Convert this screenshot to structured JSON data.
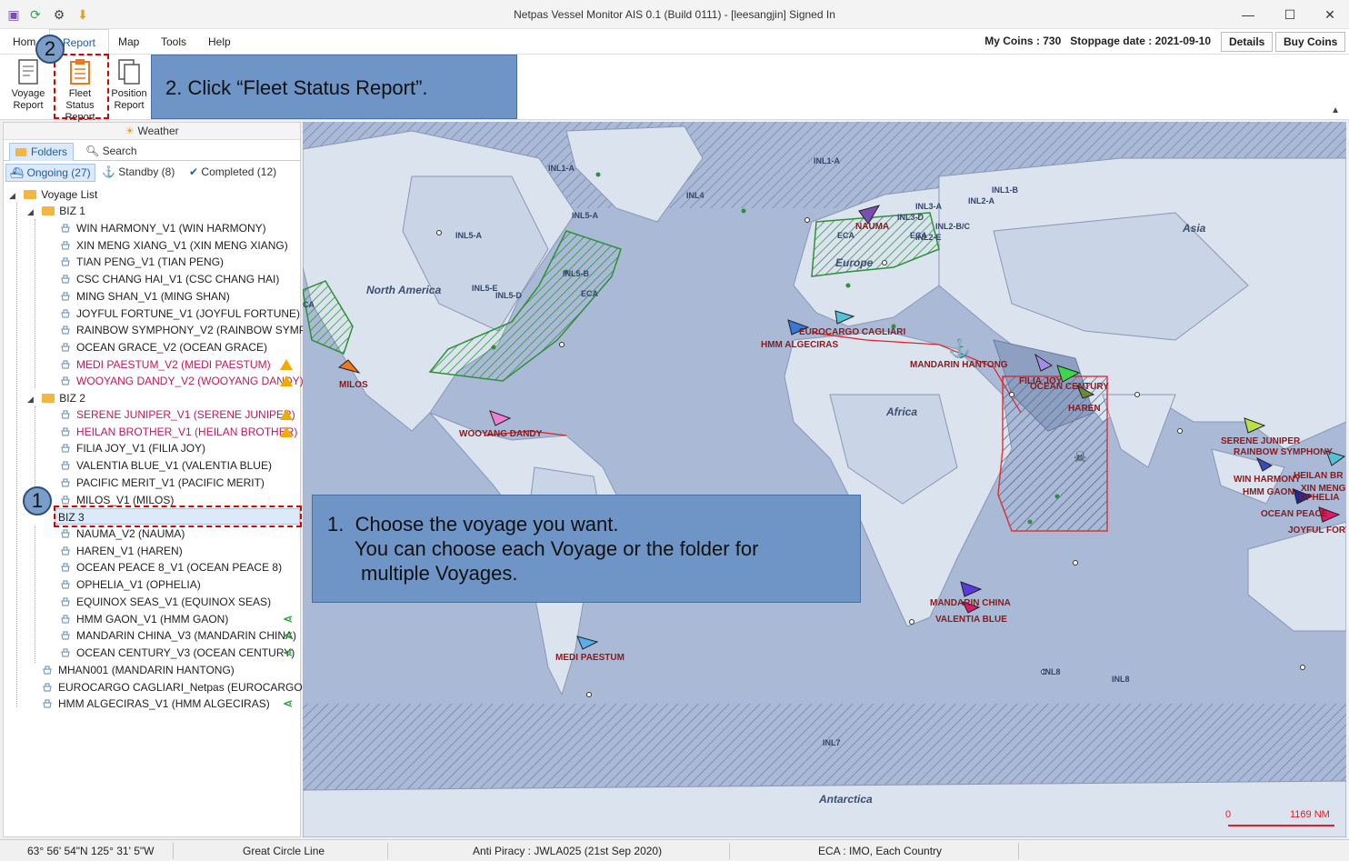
{
  "window": {
    "title": "Netpas Vessel Monitor AIS 0.1 (Build 0111) - [leesangjin] Signed In",
    "controls": [
      "—",
      "☐",
      "✕"
    ]
  },
  "menu": {
    "items": [
      "Hom",
      "Report",
      "Map",
      "Tools",
      "Help"
    ],
    "active": "Report",
    "coins_text": "My Coins : 730   Stoppage date : 2021-09-10",
    "details_label": "Details",
    "buy_label": "Buy Coins"
  },
  "ribbon": {
    "voyage_report": [
      "Voyage",
      "Report"
    ],
    "fleet_status_report": [
      "Fleet Status",
      "Report"
    ],
    "position_report": [
      "Position",
      "Report"
    ]
  },
  "callouts": {
    "step2": "2. Click “Fleet Status Report”.",
    "step1_line1": "1.  Choose the voyage you want.",
    "step1_line2": "You can choose each Voyage or the folder for",
    "step1_line3": "multiple Voyages.",
    "badge1": "1",
    "badge2": "2"
  },
  "panel": {
    "weather": "Weather",
    "tab_folders": "Folders",
    "tab_search": "Search",
    "filter_ongoing": "Ongoing (27)",
    "filter_standby": "Standby (8)",
    "filter_completed": "Completed (12)",
    "root": "Voyage List",
    "biz1": "BIZ 1",
    "biz1_items": [
      {
        "label": "WIN HARMONY_V1 (WIN HARMONY)",
        "pink": false,
        "flag": ""
      },
      {
        "label": "XIN MENG XIANG_V1 (XIN MENG XIANG)",
        "pink": false,
        "flag": ""
      },
      {
        "label": "TIAN PENG_V1 (TIAN PENG)",
        "pink": false,
        "flag": ""
      },
      {
        "label": "CSC CHANG HAI_V1 (CSC CHANG HAI)",
        "pink": false,
        "flag": ""
      },
      {
        "label": "MING SHAN_V1 (MING SHAN)",
        "pink": false,
        "flag": ""
      },
      {
        "label": "JOYFUL FORTUNE_V1 (JOYFUL FORTUNE)",
        "pink": false,
        "flag": ""
      },
      {
        "label": "RAINBOW SYMPHONY_V2 (RAINBOW SYMPH...",
        "pink": false,
        "flag": ""
      },
      {
        "label": "OCEAN GRACE_V2 (OCEAN GRACE)",
        "pink": false,
        "flag": ""
      },
      {
        "label": "MEDI PAESTUM_V2 (MEDI PAESTUM)",
        "pink": true,
        "flag": "warn"
      },
      {
        "label": "WOOYANG DANDY_V2 (WOOYANG DANDY)",
        "pink": true,
        "flag": "warn"
      }
    ],
    "biz2": "BIZ 2",
    "biz2_items": [
      {
        "label": "SERENE JUNIPER_V1 (SERENE JUNIPER)",
        "pink": true,
        "flag": "warn"
      },
      {
        "label": "HEILAN BROTHER_V1 (HEILAN BROTHER)",
        "pink": true,
        "flag": "warn"
      },
      {
        "label": "FILIA JOY_V1 (FILIA JOY)",
        "pink": false,
        "flag": ""
      },
      {
        "label": "VALENTIA BLUE_V1 (VALENTIA BLUE)",
        "pink": false,
        "flag": ""
      },
      {
        "label": "PACIFIC MERIT_V1 (PACIFIC MERIT)",
        "pink": false,
        "flag": ""
      },
      {
        "label": "MILOS_V1 (MILOS)",
        "pink": false,
        "flag": ""
      }
    ],
    "biz3": "BIZ 3",
    "biz3_items": [
      {
        "label": "NAUMA_V2 (NAUMA)",
        "pink": false,
        "flag": ""
      },
      {
        "label": "HAREN_V1 (HAREN)",
        "pink": false,
        "flag": ""
      },
      {
        "label": "OCEAN PEACE 8_V1 (OCEAN PEACE 8)",
        "pink": false,
        "flag": ""
      },
      {
        "label": "OPHELIA_V1 (OPHELIA)",
        "pink": false,
        "flag": ""
      },
      {
        "label": "EQUINOX SEAS_V1 (EQUINOX SEAS)",
        "pink": false,
        "flag": ""
      },
      {
        "label": "HMM GAON_V1 (HMM GAON)",
        "pink": false,
        "flag": "share"
      },
      {
        "label": "MANDARIN CHINA_V3 (MANDARIN CHINA)",
        "pink": false,
        "flag": "share"
      },
      {
        "label": "OCEAN CENTURY_V3 (OCEAN CENTURY)",
        "pink": false,
        "flag": "share"
      }
    ],
    "root_items": [
      {
        "label": "MHAN001 (MANDARIN HANTONG)",
        "pink": false,
        "flag": ""
      },
      {
        "label": "EUROCARGO CAGLIARI_Netpas (EUROCARGO CAG...",
        "pink": false,
        "flag": ""
      },
      {
        "label": "HMM ALGECIRAS_V1 (HMM ALGECIRAS)",
        "pink": false,
        "flag": "share"
      }
    ]
  },
  "map": {
    "vessels": [
      "MILOS",
      "WOOYANG DANDY",
      "HMM ALGECIRAS",
      "EUROCARGO CAGLIARI",
      "NAUMA",
      "MANDARIN HANTONG",
      "FILIA JOY",
      "OCEAN CENTURY",
      "HAREN",
      "SERENE JUNIPER",
      "RAINBOW SYMPHONY",
      "WIN HARMONY",
      "HMM GAON",
      "OCEAN PEACE",
      "JOYFUL FORT",
      "HEILAN BR",
      "OPHELIA",
      "XIN MENG XI",
      "MANDARIN CHINA",
      "VALENTIA BLUE",
      "MEDI PAESTUM"
    ],
    "regions": [
      "North America",
      "Africa",
      "Europe",
      "Asia",
      "Antarctica"
    ],
    "zones": [
      "INL1-A",
      "INL1-A",
      "INL4",
      "INL5-A",
      "INL5-A",
      "INL5-B",
      "INL5-E",
      "INL5-D",
      "ECA",
      "ECA",
      "ECA",
      "INL3-A",
      "INL3-D",
      "INL2-A",
      "INL1-B",
      "INL2-B/C",
      "INL2-E",
      "INL8",
      "INL8",
      "INL7",
      "CA"
    ],
    "scale_start": "0",
    "scale_end": "1169 NM",
    "colors": {
      "sea": "#a9b9d6",
      "land": "#dbe3ef",
      "land_dark": "#8ea0c2",
      "eca": "#2f8f3a",
      "piracy": "#e02020"
    }
  },
  "status": {
    "coords": "63° 56' 54\"N 125° 31' 5\"W",
    "route": "Great Circle Line",
    "piracy": "Anti Piracy : JWLA025 (21st Sep 2020)",
    "eca": "ECA : IMO, Each Country"
  }
}
